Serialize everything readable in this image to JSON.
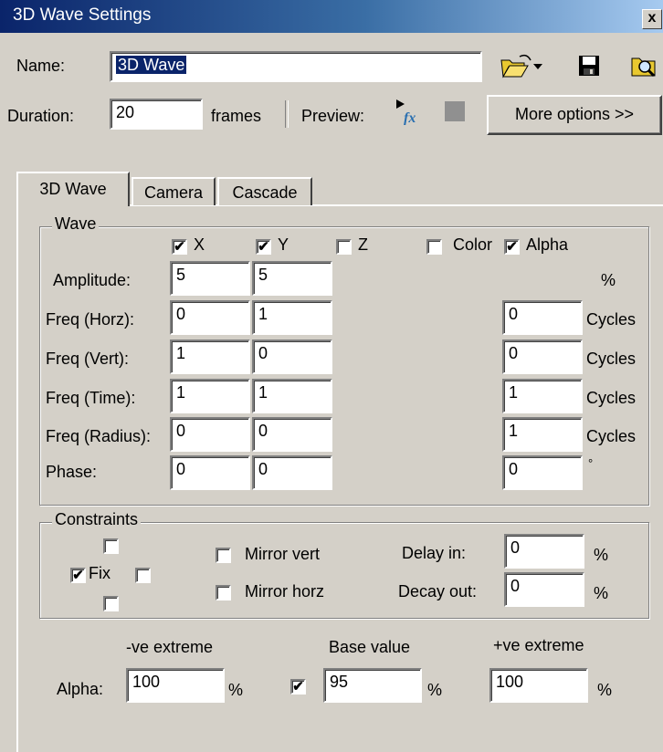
{
  "window": {
    "title": "3D Wave Settings",
    "close_glyph": "x"
  },
  "name_row": {
    "label": "Name:",
    "value": "3D Wave"
  },
  "duration_row": {
    "label": "Duration:",
    "value": "20",
    "unit": "frames",
    "preview_label": "Preview:",
    "more_options": "More options >>"
  },
  "tabs": [
    {
      "label": "3D Wave",
      "active": true
    },
    {
      "label": "Camera"
    },
    {
      "label": "Cascade"
    }
  ],
  "wave": {
    "group_label": "Wave",
    "axes": [
      {
        "label": "X",
        "checked": true
      },
      {
        "label": "Y",
        "checked": true
      },
      {
        "label": "Z",
        "checked": false
      }
    ],
    "color": {
      "label": "Color",
      "checked": false
    },
    "alpha": {
      "label": "Alpha",
      "checked": true
    },
    "rows": [
      {
        "label": "Amplitude:",
        "x": "5",
        "y": "5",
        "a": "",
        "unit": "%"
      },
      {
        "label": "Freq (Horz):",
        "x": "0",
        "y": "1",
        "a": "0",
        "unit": "Cycles"
      },
      {
        "label": "Freq (Vert):",
        "x": "1",
        "y": "0",
        "a": "0",
        "unit": "Cycles"
      },
      {
        "label": "Freq (Time):",
        "x": "1",
        "y": "1",
        "a": "1",
        "unit": "Cycles"
      },
      {
        "label": "Freq (Radius):",
        "x": "0",
        "y": "0",
        "a": "1",
        "unit": "Cycles"
      },
      {
        "label": "Phase:",
        "x": "0",
        "y": "0",
        "a": "0",
        "unit": "°"
      }
    ]
  },
  "constraints": {
    "group_label": "Constraints",
    "fix_label": "Fix",
    "fix_checked": true,
    "mirror_vert": "Mirror vert",
    "mirror_horz": "Mirror horz",
    "delay_label": "Delay in:",
    "delay_value": "0",
    "delay_unit": "%",
    "decay_label": "Decay out:",
    "decay_value": "0",
    "decay_unit": "%"
  },
  "alpha_row": {
    "neg_header": "-ve extreme",
    "base_header": "Base value",
    "pos_header": "+ve extreme",
    "label": "Alpha:",
    "neg_value": "100",
    "neg_unit": "%",
    "base_checked": true,
    "base_value": "95",
    "base_unit": "%",
    "pos_value": "100",
    "pos_unit": "%"
  },
  "check_glyph": "✔",
  "icons": [
    "folder-open-icon",
    "dropdown-arrow-icon",
    "save-icon",
    "browse-icon",
    "preview-play-icon",
    "stop-icon"
  ]
}
